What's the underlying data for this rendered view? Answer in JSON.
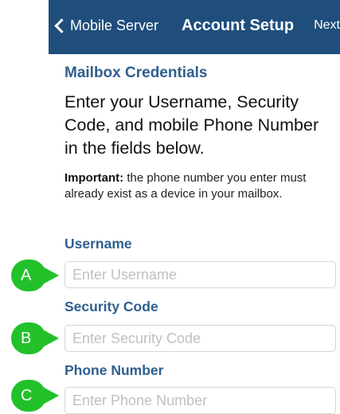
{
  "nav": {
    "back_label": "Mobile Server",
    "title": "Account Setup",
    "next_label": "Next"
  },
  "content": {
    "section_title": "Mailbox Credentials",
    "lead": "Enter your Username, Security Code, and mobile Phone Number in the fields below.",
    "note_prefix": "Important:",
    "note_text": " the phone number you enter must already exist as a device in your mailbox."
  },
  "fields": {
    "username": {
      "label": "Username",
      "value": "",
      "placeholder": "Enter Username"
    },
    "security_code": {
      "label": "Security Code",
      "value": "",
      "placeholder": "Enter Security Code"
    },
    "phone": {
      "label": "Phone Number",
      "value": "",
      "placeholder": "Enter Phone Number"
    }
  },
  "callouts": [
    "A",
    "B",
    "C"
  ],
  "colors": {
    "navbar": "#1f4e7c",
    "heading_blue": "#2f5f8f",
    "callout_green": "#22c12a",
    "placeholder_gray": "#c0c0c0"
  }
}
